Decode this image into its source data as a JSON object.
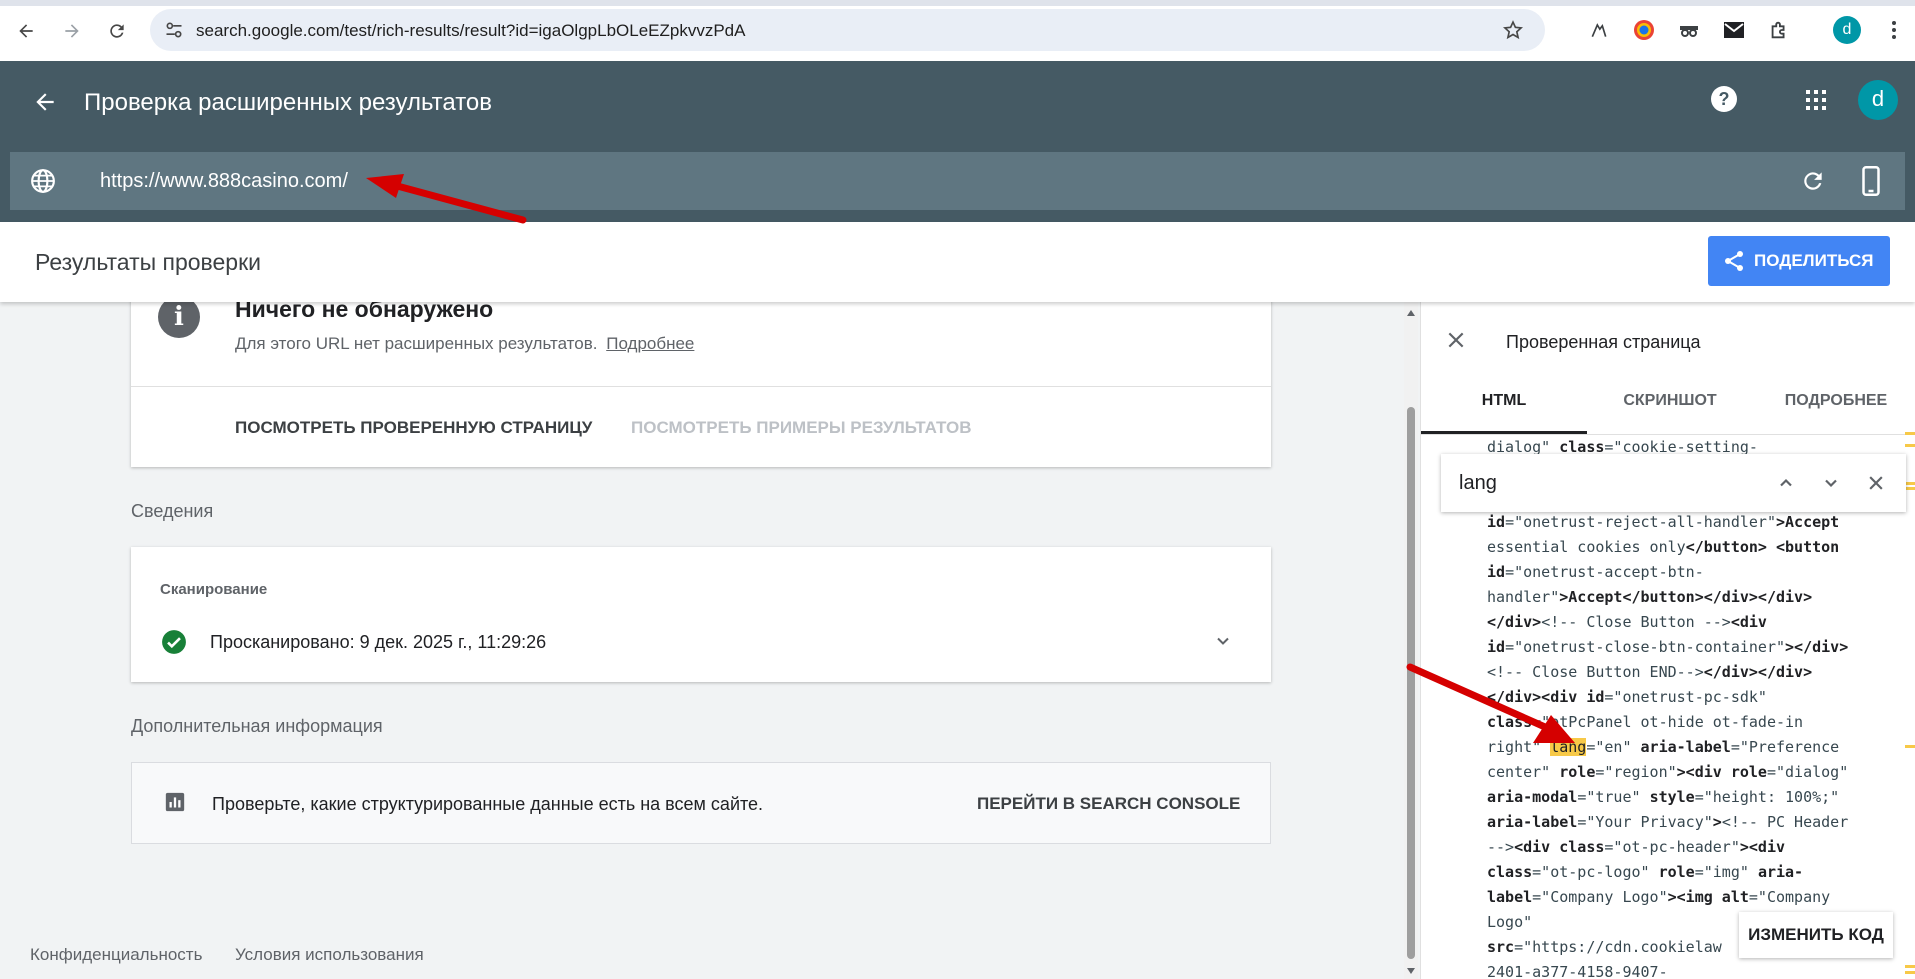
{
  "browser": {
    "url": "search.google.com/test/rich-results/result?id=igaOlgpLbOLeEZpkvvzPdA",
    "profile_initial": "d"
  },
  "header": {
    "title": "Проверка расширенных результатов",
    "avatar_initial": "d",
    "tested_url": "https://www.888casino.com/"
  },
  "results": {
    "title": "Результаты проверки",
    "share_label": "ПОДЕЛИТЬСЯ"
  },
  "status_card": {
    "heading": "Ничего не обнаружено",
    "description": "Для этого URL нет расширенных результатов.",
    "learn_more": "Подробнее",
    "action_view_page": "ПОСМОТРЕТЬ ПРОВЕРЕННУЮ СТРАНИЦУ",
    "action_view_examples": "ПОСМОТРЕТЬ ПРИМЕРЫ РЕЗУЛЬТАТОВ"
  },
  "details": {
    "section_title": "Сведения",
    "crawl_label": "Сканирование",
    "crawl_status": "Просканировано: 9 дек. 2025 г., 11:29:26"
  },
  "additional": {
    "section_title": "Дополнительная информация",
    "text": "Проверьте, какие структурированные данные есть на всем сайте.",
    "action": "ПЕРЕЙТИ В SEARCH CONSOLE"
  },
  "footer": {
    "privacy": "Конфиденциальность",
    "terms": "Условия использования"
  },
  "panel": {
    "title": "Проверенная страница",
    "tabs": [
      "HTML",
      "СКРИНШОТ",
      "ПОДРОБНЕЕ"
    ],
    "active_tab": "HTML",
    "search_value": "lang",
    "edit_code": "ИЗМЕНИТЬ КОД",
    "code_lines": [
      [
        [
          "dialog\" ",
          "str"
        ],
        [
          "class",
          "tag"
        ],
        [
          "=\"cookie-setting-",
          "str"
        ]
      ],
      [
        [
          "",
          ""
        ]
      ],
      [
        [
          "",
          ""
        ]
      ],
      [
        [
          "id",
          "tag"
        ],
        [
          "=\"onetrust-reject-all-handler\"",
          "str"
        ],
        [
          ">Accept",
          "tag"
        ]
      ],
      [
        [
          "essential cookies only",
          "str"
        ],
        [
          "</button> <button",
          "tag"
        ]
      ],
      [
        [
          "id",
          "tag"
        ],
        [
          "=\"onetrust-accept-btn-",
          "str"
        ]
      ],
      [
        [
          "handler\"",
          "str"
        ],
        [
          ">Accept</button></div></div>",
          "tag"
        ]
      ],
      [
        [
          "</div>",
          "tag"
        ],
        [
          "<!-- Close Button -->",
          "str"
        ],
        [
          "<div",
          "tag"
        ]
      ],
      [
        [
          "id",
          "tag"
        ],
        [
          "=\"onetrust-close-btn-container\"",
          "str"
        ],
        [
          "></div>",
          "tag"
        ]
      ],
      [
        [
          "<!-- Close Button END-->",
          "str"
        ],
        [
          "</div></div>",
          "tag"
        ]
      ],
      [
        [
          "</div><div id",
          "tag"
        ],
        [
          "=\"onetrust-pc-sdk\"",
          "str"
        ]
      ],
      [
        [
          "class",
          "tag"
        ],
        [
          "=\"otPcPanel ot-hide ot-fade-in",
          "str"
        ]
      ],
      [
        [
          "right\" ",
          "str"
        ],
        [
          "lang",
          "hl"
        ],
        [
          "=\"en\" ",
          "str"
        ],
        [
          "aria-label",
          "tag"
        ],
        [
          "=\"Preference",
          "str"
        ]
      ],
      [
        [
          "center\" ",
          "str"
        ],
        [
          "role",
          "tag"
        ],
        [
          "=\"region\"",
          "str"
        ],
        [
          "><div role",
          "tag"
        ],
        [
          "=\"dialog\"",
          "str"
        ]
      ],
      [
        [
          "aria-modal",
          "tag"
        ],
        [
          "=\"true\" ",
          "str"
        ],
        [
          "style",
          "tag"
        ],
        [
          "=\"height: 100%;\"",
          "str"
        ]
      ],
      [
        [
          "aria-label",
          "tag"
        ],
        [
          "=\"Your Privacy\"",
          "str"
        ],
        [
          ">",
          "tag"
        ],
        [
          "<!-- PC Header",
          "str"
        ]
      ],
      [
        [
          "-->",
          "str"
        ],
        [
          "<div class",
          "tag"
        ],
        [
          "=\"ot-pc-header\"",
          "str"
        ],
        [
          "><div",
          "tag"
        ]
      ],
      [
        [
          "class",
          "tag"
        ],
        [
          "=\"ot-pc-logo\" ",
          "str"
        ],
        [
          "role",
          "tag"
        ],
        [
          "=\"img\" ",
          "str"
        ],
        [
          "aria-",
          "tag"
        ]
      ],
      [
        [
          "label",
          "tag"
        ],
        [
          "=\"Company Logo\"",
          "str"
        ],
        [
          "><img alt",
          "tag"
        ],
        [
          "=\"Company",
          "str"
        ]
      ],
      [
        [
          "Logo\"",
          "str"
        ]
      ],
      [
        [
          "src",
          "tag"
        ],
        [
          "=\"https://cdn.cookielaw",
          "str"
        ]
      ],
      [
        [
          "2401-a377-4158-9407-",
          "str"
        ]
      ]
    ]
  }
}
